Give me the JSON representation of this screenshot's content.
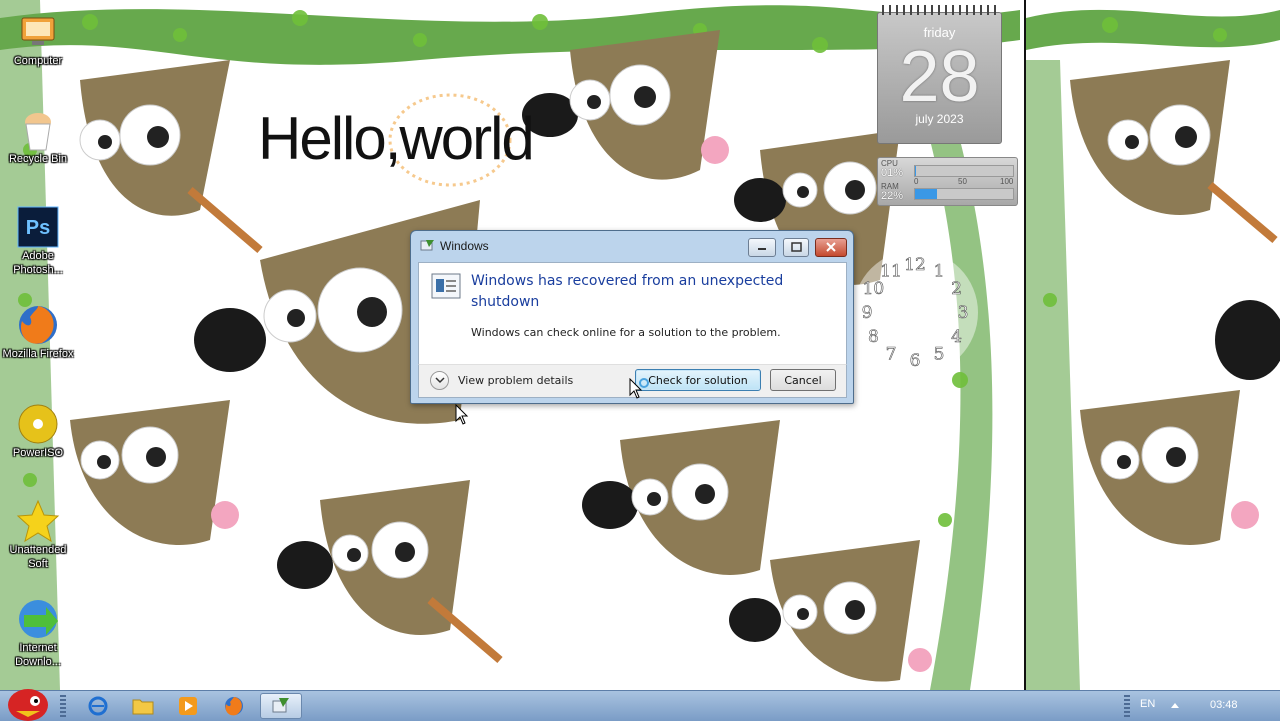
{
  "desktop": {
    "icons": [
      {
        "label": "Computer",
        "icon": "computer-icon"
      },
      {
        "label": "Recycle Bin",
        "icon": "recycle-bin-icon"
      },
      {
        "label": "Adobe Photosh...",
        "icon": "photoshop-icon"
      },
      {
        "label": "Mozilla Firefox",
        "icon": "firefox-icon"
      },
      {
        "label": "PowerISO",
        "icon": "poweriso-icon"
      },
      {
        "label": "Unattended Soft",
        "icon": "star-icon"
      },
      {
        "label": "Internet Downlo...",
        "icon": "internet-download-icon"
      }
    ],
    "photoshop_glyph": "Ps",
    "wallpaper_text": "Hello,world"
  },
  "gadgets": {
    "calendar": {
      "day": "friday",
      "date": "28",
      "month_year": "july 2023"
    },
    "meter": {
      "cpu_label": "CPU",
      "cpu_value": "01%",
      "cpu_level": 0.01,
      "ram_label": "RAM",
      "ram_value": "22%",
      "ram_level": 0.22,
      "scale_start": "0",
      "scale_mid": "50",
      "scale_end": "100"
    },
    "clock": {
      "numbers": [
        "12",
        "1",
        "2",
        "3",
        "4",
        "5",
        "6",
        "7",
        "8",
        "9",
        "10",
        "11"
      ]
    }
  },
  "dialog": {
    "title": "Windows",
    "heading": "Windows has recovered from an unexpected shutdown",
    "message": "Windows can check online for a solution to the problem.",
    "details_label": "View problem details",
    "check_label": "Check for solution",
    "cancel_label": "Cancel"
  },
  "taskbar": {
    "pinned": [
      "start-orb-icon",
      "internet-explorer-icon",
      "folder-icon",
      "media-player-icon",
      "firefox-icon",
      "windows-problem-icon"
    ],
    "language": "EN",
    "time": "03:48"
  },
  "colors": {
    "dialog_heading": "#1a3e9e",
    "taskbar": "#7a9cc6",
    "calendar": "#a8a8a8",
    "vine": "#3f8a2a"
  }
}
